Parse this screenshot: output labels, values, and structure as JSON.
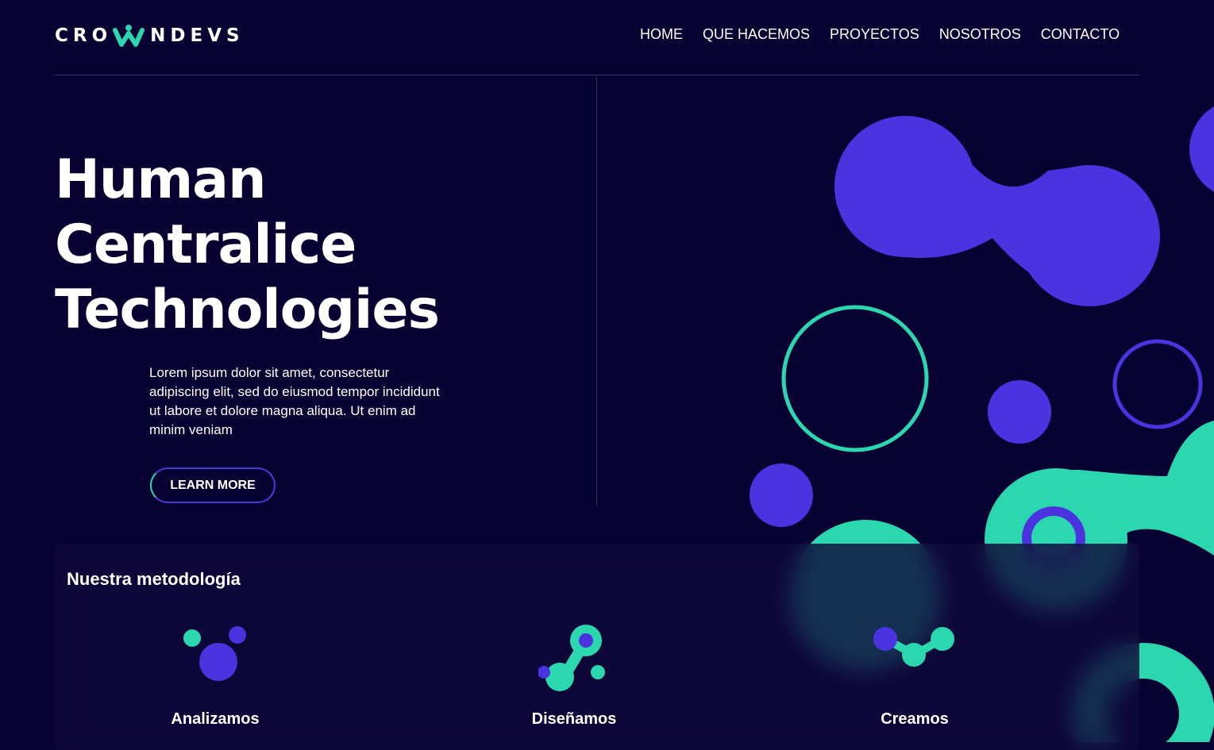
{
  "brand": {
    "logo_text_left": "CRO",
    "logo_text_right": "NDEVS"
  },
  "nav": {
    "items": [
      {
        "label": "HOME"
      },
      {
        "label": "QUE HACEMOS"
      },
      {
        "label": "PROYECTOS"
      },
      {
        "label": "NOSOTROS"
      },
      {
        "label": "CONTACTO"
      }
    ]
  },
  "hero": {
    "title_lines": [
      "Human",
      "Centralice",
      "Technologies"
    ],
    "description": "Lorem ipsum dolor sit amet, consectetur adipiscing elit, sed do eiusmod tempor incididunt ut labore et dolore magna aliqua. Ut enim ad minim veniam",
    "cta_label": "LEARN MORE"
  },
  "methodology": {
    "title": "Nuestra metodología",
    "steps": [
      {
        "label": "Analizamos",
        "icon": "molecule-cluster-icon"
      },
      {
        "label": "Diseñamos",
        "icon": "molecule-chain-icon"
      },
      {
        "label": "Creamos",
        "icon": "molecule-link-icon"
      }
    ]
  },
  "colors": {
    "background": "#080232",
    "primary_purple": "#4b33e0",
    "accent_teal": "#2bd7ae",
    "text": "#ffffff"
  }
}
